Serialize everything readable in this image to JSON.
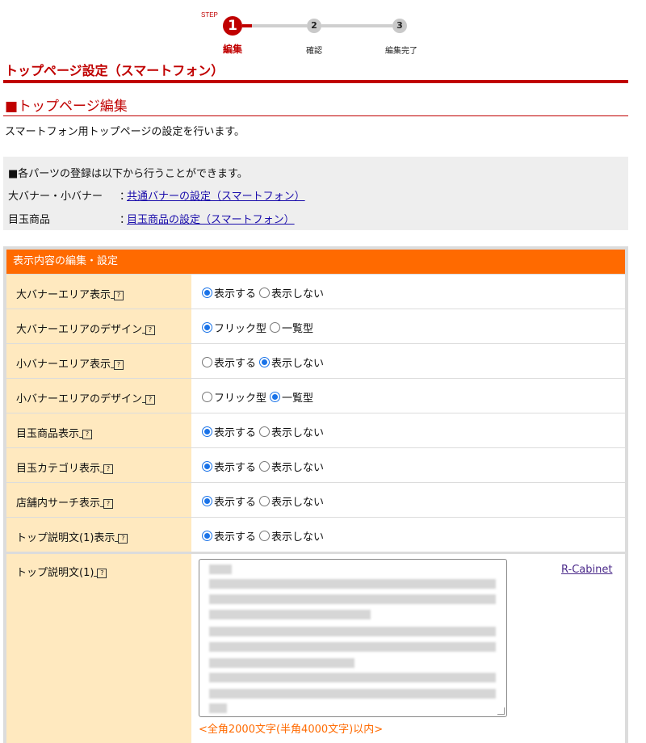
{
  "stepper": {
    "step_word": "STEP",
    "steps": [
      {
        "num": "1",
        "label": "編集"
      },
      {
        "num": "2",
        "label": "確認"
      },
      {
        "num": "3",
        "label": "編集完了"
      }
    ]
  },
  "page_title": "トップページ設定（スマートフォン）",
  "section_title": "■トップページ編集",
  "intro": "スマートフォン用トップページの設定を行います。",
  "parts": {
    "heading": "■各パーツの登録は以下から行うことができます。",
    "rows": [
      {
        "label": "大バナー・小バナー",
        "sep": "：",
        "link": "共通バナーの設定（スマートフォン）"
      },
      {
        "label": "目玉商品",
        "sep": "：",
        "link": "目玉商品の設定（スマートフォン）"
      }
    ]
  },
  "settings": {
    "header": "表示内容の編集・設定",
    "help_glyph": "?",
    "rows": [
      {
        "label": "大バナーエリア表示",
        "options": [
          "表示する",
          "表示しない"
        ],
        "selected": 0
      },
      {
        "label": "大バナーエリアのデザイン",
        "options": [
          "フリック型",
          "一覧型"
        ],
        "selected": 0
      },
      {
        "label": "小バナーエリア表示",
        "options": [
          "表示する",
          "表示しない"
        ],
        "selected": 1
      },
      {
        "label": "小バナーエリアのデザイン",
        "options": [
          "フリック型",
          "一覧型"
        ],
        "selected": 1
      },
      {
        "label": "目玉商品表示",
        "options": [
          "表示する",
          "表示しない"
        ],
        "selected": 0
      },
      {
        "label": "目玉カテゴリ表示",
        "options": [
          "表示する",
          "表示しない"
        ],
        "selected": 0
      },
      {
        "label": "店舗内サーチ表示",
        "options": [
          "表示する",
          "表示しない"
        ],
        "selected": 0
      },
      {
        "label": "トップ説明文(1)表示",
        "options": [
          "表示する",
          "表示しない"
        ],
        "selected": 0
      }
    ],
    "description": {
      "label": "トップ説明文(1)",
      "link": "R-Cabinet",
      "note": "<全角2000文字(半角4000文字)以内>"
    }
  },
  "colors": {
    "brand_red": "#c00000",
    "header_orange": "#ff6a00",
    "label_bg": "#ffe9bf",
    "radio_blue": "#1a73e8"
  }
}
